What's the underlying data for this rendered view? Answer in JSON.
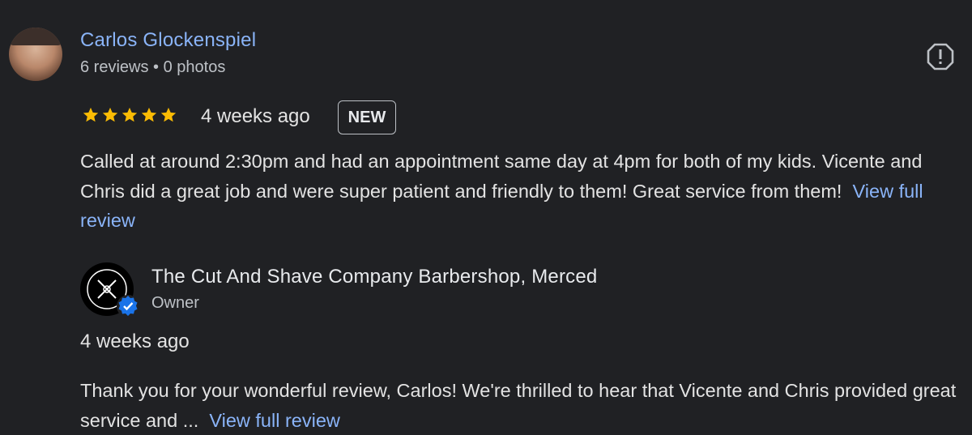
{
  "review": {
    "reviewer_name": "Carlos Glockenspiel",
    "reviewer_meta": "6 reviews • 0 photos",
    "rating": 5,
    "max_rating": 5,
    "time": "4 weeks ago",
    "badge": "NEW",
    "text": "Called at around 2:30pm and had an appointment same day at 4pm for both of my kids. Vicente and Chris did a great job and were super patient and friendly to them! Great service from them!",
    "link_label": "View full review"
  },
  "owner_reply": {
    "business_name": "The Cut And Shave Company Barbershop, Merced",
    "role": "Owner",
    "time": "4 weeks ago",
    "text": "Thank you for your wonderful review, Carlos! We're thrilled to hear that Vicente and Chris provided great service and ...",
    "link_label": "View full review"
  },
  "icons": {
    "report": "report-flag-icon",
    "star": "star-icon",
    "verified": "verified-check-icon"
  },
  "colors": {
    "background": "#202124",
    "link": "#8ab4f8",
    "star": "#fbbc04",
    "verified": "#1a73e8"
  }
}
